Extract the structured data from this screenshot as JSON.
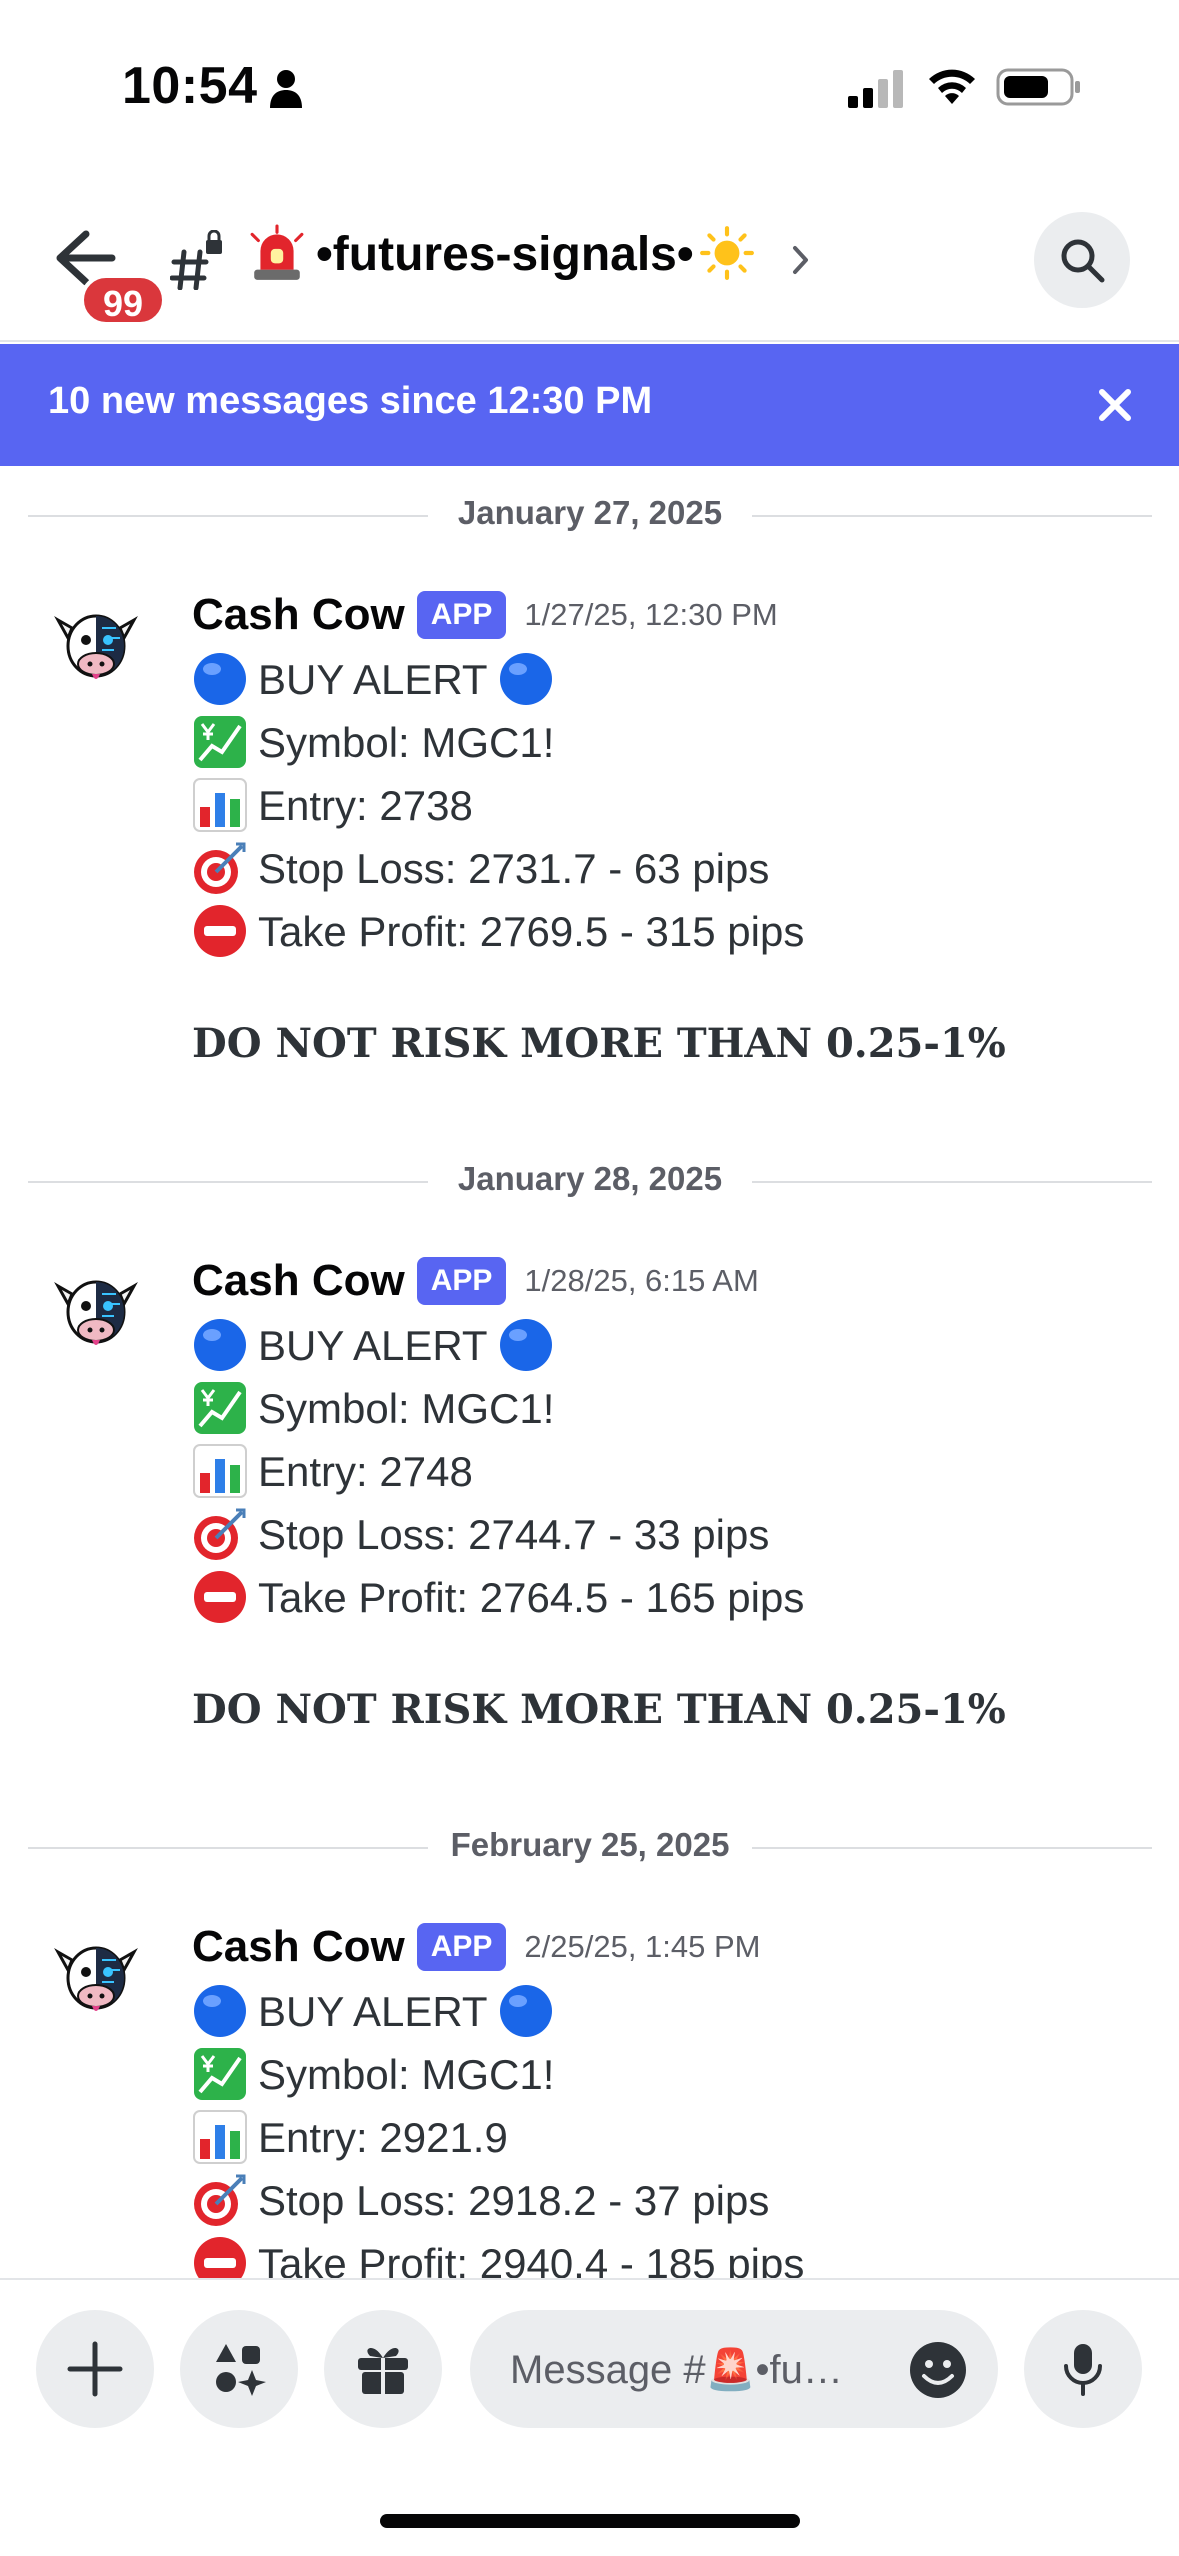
{
  "status_bar": {
    "time": "10:54",
    "icons": [
      "person-icon",
      "cellular-signal-icon",
      "wifi-icon",
      "battery-icon"
    ]
  },
  "header": {
    "unread_badge": "99",
    "channel_name": "•futures-signals•",
    "icons": [
      "back-arrow-icon",
      "locked-hash-icon",
      "siren-emoji-icon",
      "sun-emoji-icon",
      "chevron-right-icon",
      "search-icon"
    ]
  },
  "new_messages_bar": {
    "text": "10 new messages since 12:30 PM",
    "close_icon": "close-icon"
  },
  "messages": [
    {
      "date_divider": "January 27, 2025",
      "author": "Cash Cow",
      "tag": "APP",
      "timestamp": "1/27/25, 12:30 PM",
      "alert": "BUY ALERT",
      "symbol": "Symbol: MGC1!",
      "entry": "Entry:  2738",
      "stop_loss": "Stop Loss:  2731.7 - 63 pips",
      "take_profit": "Take Profit:  2769.5 - 315 pips",
      "warning": "DO NOT RISK MORE THAN 0.25-1%"
    },
    {
      "date_divider": "January 28, 2025",
      "author": "Cash Cow",
      "tag": "APP",
      "timestamp": "1/28/25, 6:15 AM",
      "alert": "BUY ALERT",
      "symbol": "Symbol: MGC1!",
      "entry": "Entry:  2748",
      "stop_loss": "Stop Loss:  2744.7 - 33 pips",
      "take_profit": "Take Profit:  2764.5 - 165 pips",
      "warning": "DO NOT RISK MORE THAN 0.25-1%"
    },
    {
      "date_divider": "February 25, 2025",
      "author": "Cash Cow",
      "tag": "APP",
      "timestamp": "2/25/25, 1:45 PM",
      "alert": "BUY ALERT",
      "symbol": "Symbol: MGC1!",
      "entry": "Entry:  2921.9",
      "stop_loss": "Stop Loss:  2918.2 - 37 pips",
      "take_profit": "Take Profit:  2940.4 - 185 pips"
    }
  ],
  "input_bar": {
    "placeholder": "Message #🚨•fu…",
    "icons": [
      "plus-icon",
      "apps-icon",
      "gift-icon",
      "emoji-icon",
      "microphone-icon"
    ]
  },
  "colors": {
    "blurple": "#5865f2",
    "badge_red": "#da373c",
    "text_primary": "#060607",
    "text_muted": "#5c5e66"
  }
}
